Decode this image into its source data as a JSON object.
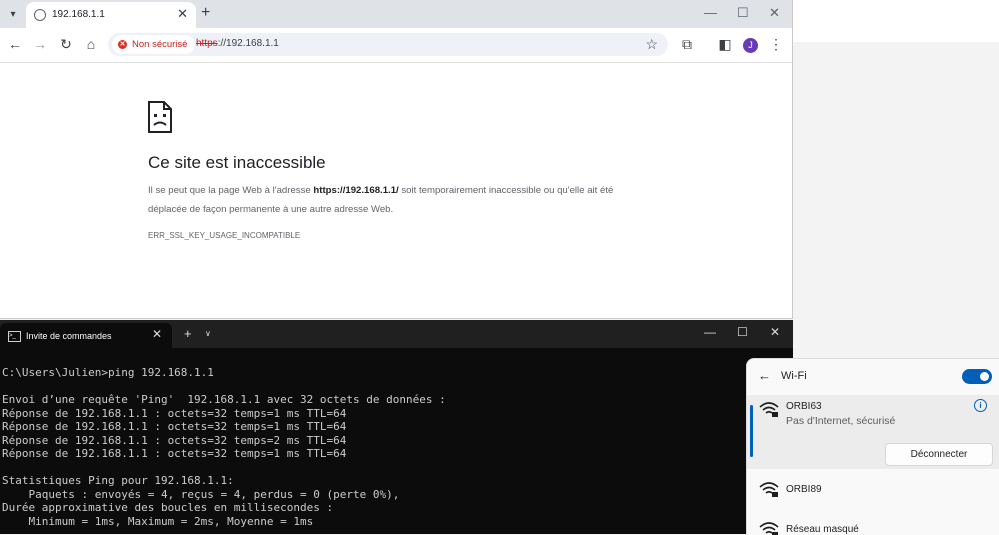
{
  "browser": {
    "tab_title": "192.168.1.1",
    "security_chip": "Non sécurisé",
    "url_protocol": "https",
    "url_rest": "://192.168.1.1",
    "profile_initial": "J",
    "error": {
      "title": "Ce site est inaccessible",
      "desc_prefix": "Il se peut que la page Web à l'adresse ",
      "desc_url": "https://192.168.1.1/",
      "desc_suffix": " soit temporairement inaccessible ou qu'elle ait été déplacée de façon permanente à une autre adresse Web.",
      "code": "ERR_SSL_KEY_USAGE_INCOMPATIBLE"
    }
  },
  "terminal": {
    "tab_title": "Invite de commandes",
    "lines": [
      "C:\\Users\\Julien>ping 192.168.1.1",
      "",
      "Envoi d’une requête 'Ping'  192.168.1.1 avec 32 octets de données :",
      "Réponse de 192.168.1.1 : octets=32 temps=1 ms TTL=64",
      "Réponse de 192.168.1.1 : octets=32 temps=1 ms TTL=64",
      "Réponse de 192.168.1.1 : octets=32 temps=2 ms TTL=64",
      "Réponse de 192.168.1.1 : octets=32 temps=1 ms TTL=64",
      "",
      "Statistiques Ping pour 192.168.1.1:",
      "    Paquets : envoyés = 4, reçus = 4, perdus = 0 (perte 0%),",
      "Durée approximative des boucles en millisecondes :",
      "    Minimum = 1ms, Maximum = 2ms, Moyenne = 1ms"
    ]
  },
  "wifi": {
    "title": "Wi-Fi",
    "toggle_on": true,
    "networks": [
      {
        "name": "ORBI63",
        "status": "Pas d'Internet, sécurisé",
        "button": "Déconnecter"
      },
      {
        "name": "ORBI89"
      },
      {
        "name": "Réseau masqué"
      }
    ]
  },
  "colors": {
    "accent": "#005fb8",
    "warning": "#d93025",
    "profile": "#673ab7"
  }
}
